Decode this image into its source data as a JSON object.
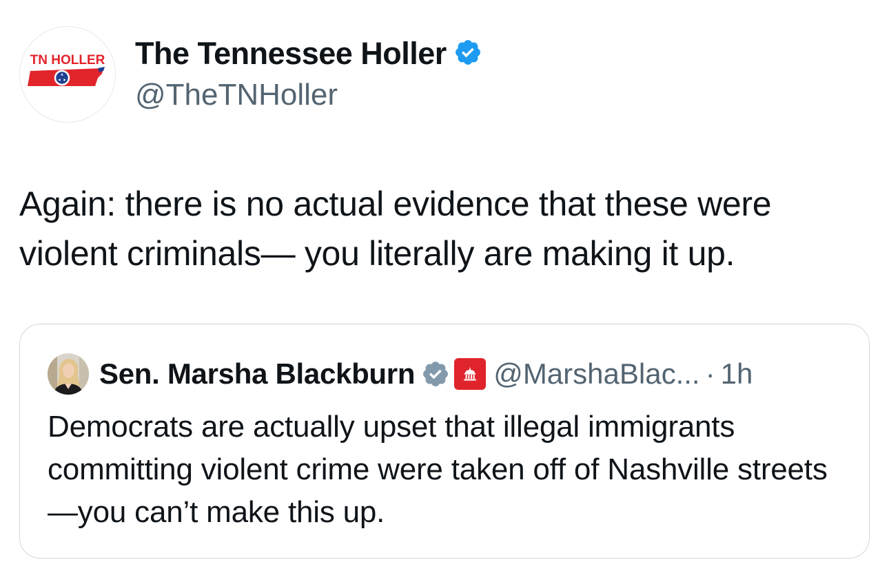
{
  "author": {
    "display_name": "The Tennessee Holler",
    "handle": "@TheTNHoller",
    "avatar_label": "TN HOLLER",
    "verified_icon": "verified-badge-icon"
  },
  "tweet": {
    "text": "Again: there is no actual evidence that these were violent criminals— you literally are making it up."
  },
  "quoted_tweet": {
    "display_name": "Sen. Marsha Blackburn",
    "handle": "@MarshaBlac...",
    "separator": "·",
    "time": "1h",
    "verified_icon": "gray-verified-badge-icon",
    "affiliation_icon": "government-building-icon",
    "text": "Democrats are actually upset that illegal immigrants committing violent crime were taken off of Nashville streets—you can’t make this up."
  },
  "colors": {
    "verified_blue": "#1d9bf0",
    "gov_gray_badge": "#829aab",
    "affiliation_red": "#e0242c",
    "tn_red": "#e2242b",
    "tn_blue": "#1f3f8f"
  }
}
